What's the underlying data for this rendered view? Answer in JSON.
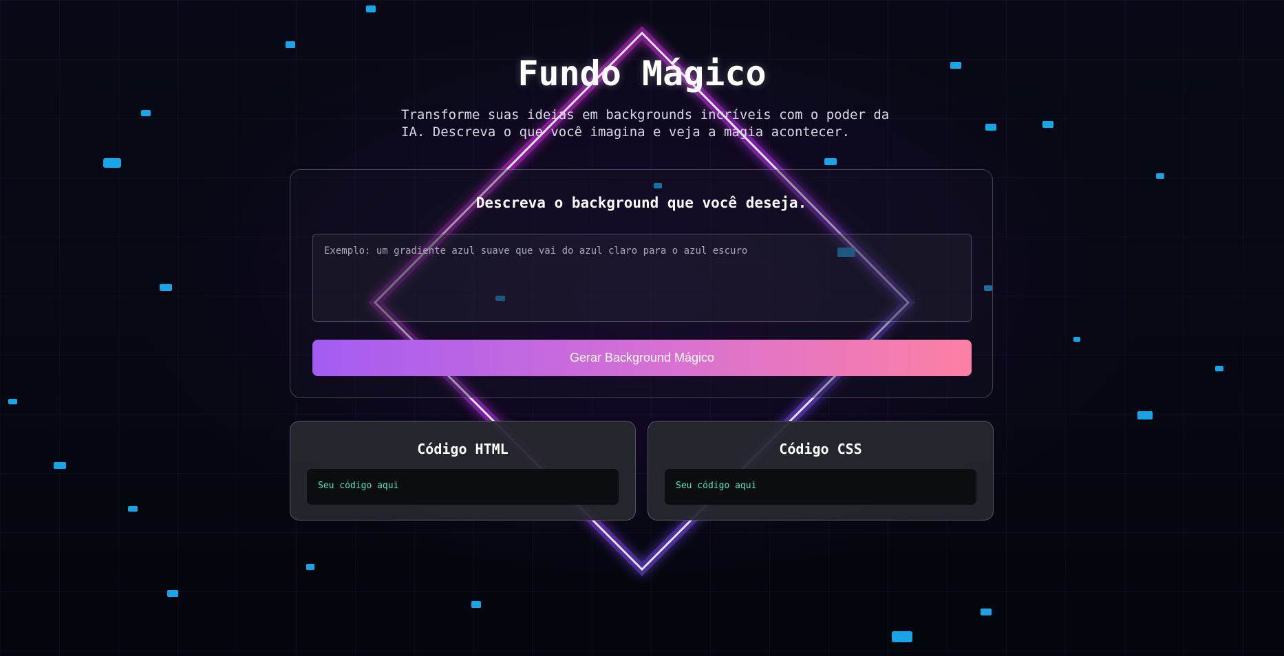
{
  "header": {
    "title": "Fundo Mágico",
    "subtitle_line1": "Transforme suas ideias em backgrounds incríveis com o poder da",
    "subtitle_line2": "IA. Descreva o que você imagina e veja a magia acontecer."
  },
  "generator": {
    "heading": "Descreva o background que você deseja.",
    "prompt_placeholder": "Exemplo: um gradiente azul suave que vai do azul claro para o azul escuro",
    "prompt_value": "",
    "button_label": "Gerar Background Mágico"
  },
  "output": {
    "html": {
      "title": "Código HTML",
      "code": "Seu código aqui"
    },
    "css": {
      "title": "Código CSS",
      "code": "Seu código aqui"
    }
  },
  "colors": {
    "background": "#05070f",
    "button_gradient_start": "#a35cf2",
    "button_gradient_end": "#fd80a4",
    "code_text": "#54e8c0",
    "neon_pink": "#ff2bd6",
    "neon_blue": "#3f6bff"
  }
}
